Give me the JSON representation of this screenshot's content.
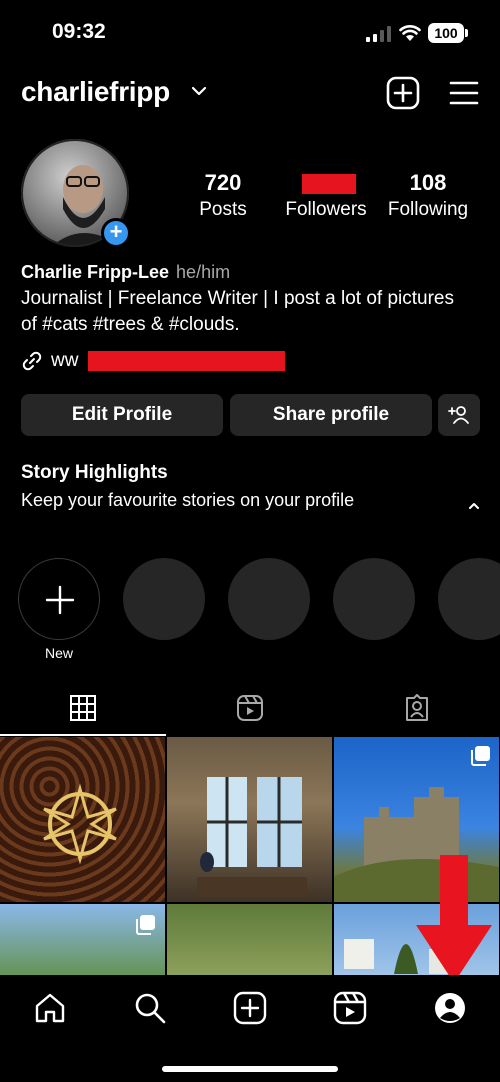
{
  "status_bar": {
    "time": "09:32",
    "battery": "100"
  },
  "header": {
    "username": "charliefripp"
  },
  "profile": {
    "stats": {
      "posts": {
        "count": "720",
        "label": "Posts"
      },
      "followers": {
        "count": "",
        "label": "Followers"
      },
      "following": {
        "count": "108",
        "label": "Following"
      }
    },
    "name": "Charlie Fripp-Lee",
    "pronouns": "he/him",
    "bio": "Journalist | Freelance Writer | I post a lot of pictures of #cats #trees & #clouds.",
    "link_prefix": "ww"
  },
  "buttons": {
    "edit_profile": "Edit Profile",
    "share_profile": "Share profile"
  },
  "highlights": {
    "title": "Story Highlights",
    "subtitle": "Keep your favourite stories on your profile",
    "new_label": "New"
  },
  "colors": {
    "accent_blue": "#3797f0",
    "redaction": "#e5141f",
    "button_bg": "#262626"
  }
}
